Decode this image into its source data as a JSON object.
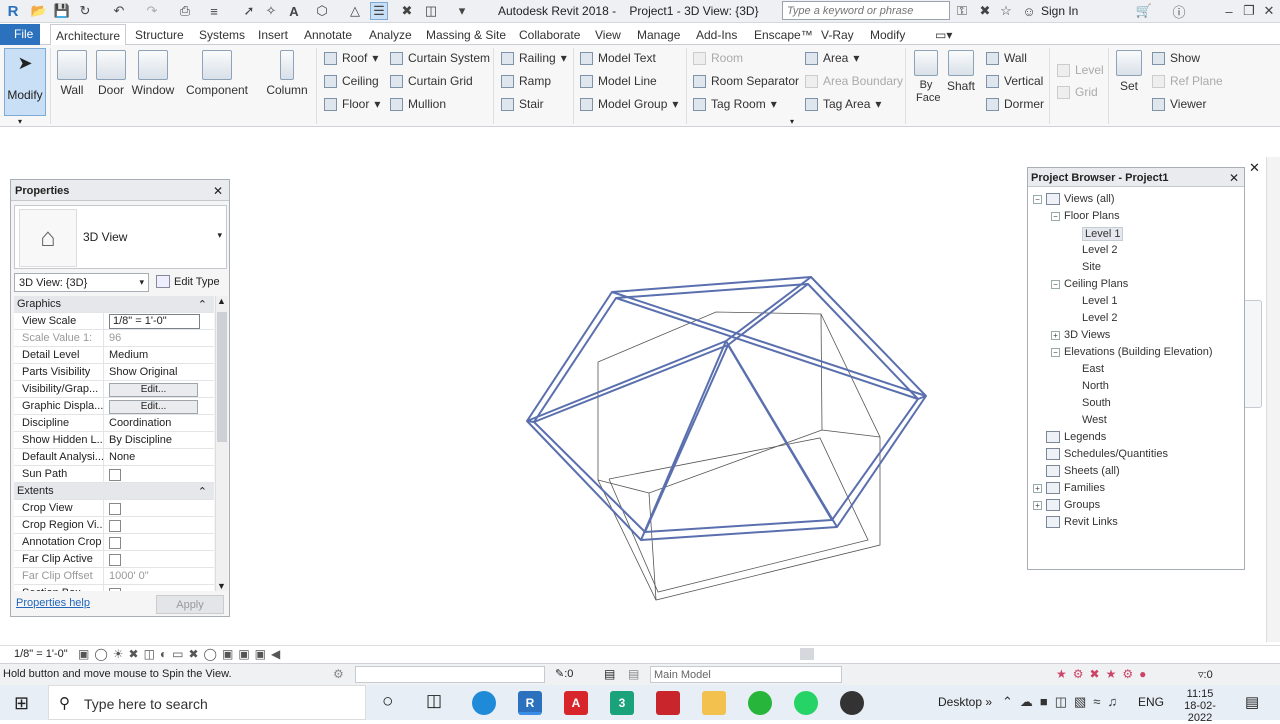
{
  "window": {
    "title_app": "Autodesk Revit 2018 -",
    "title_doc": "Project1 - 3D View: {3D}",
    "search_placeholder": "Type a keyword or phrase",
    "signin": "Sign In"
  },
  "tabs": [
    "File",
    "Architecture",
    "Structure",
    "Systems",
    "Insert",
    "Annotate",
    "Analyze",
    "Massing & Site",
    "Collaborate",
    "View",
    "Manage",
    "Add-Ins",
    "Enscape™",
    "V-Ray",
    "Modify"
  ],
  "ribbon": {
    "modify": "Modify",
    "big": [
      "Wall",
      "Door",
      "Window",
      "Component",
      "Column"
    ],
    "roof": "Roof",
    "ceiling": "Ceiling",
    "floor": "Floor",
    "curtain_system": "Curtain System",
    "curtain_grid": "Curtain Grid",
    "mullion": "Mullion",
    "railing": "Railing",
    "ramp": "Ramp",
    "stair": "Stair",
    "model_text": "Model Text",
    "model_line": "Model Line",
    "model_group": "Model Group",
    "room": "Room",
    "room_separator": "Room Separator",
    "tag_room": "Tag Room",
    "area": "Area",
    "area_boundary": "Area Boundary",
    "tag_area": "Tag Area",
    "by_face": "By Face",
    "shaft": "Shaft",
    "wall": "Wall",
    "vertical": "Vertical",
    "dormer": "Dormer",
    "level": "Level",
    "grid": "Grid",
    "set": "Set",
    "show": "Show",
    "ref_plane": "Ref Plane",
    "viewer": "Viewer"
  },
  "properties": {
    "title": "Properties",
    "type_name": "3D View",
    "view_selector": "3D View: {3D}",
    "edit_type": "Edit Type",
    "rows": [
      {
        "cat": "Graphics"
      },
      {
        "k": "View Scale",
        "v": "1/8\" = 1'-0\"",
        "input": true
      },
      {
        "k": "Scale Value    1:",
        "v": "96",
        "dim": true
      },
      {
        "k": "Detail Level",
        "v": "Medium"
      },
      {
        "k": "Parts Visibility",
        "v": "Show Original"
      },
      {
        "k": "Visibility/Grap...",
        "v": "Edit...",
        "btn": true
      },
      {
        "k": "Graphic Displa...",
        "v": "Edit...",
        "btn": true
      },
      {
        "k": "Discipline",
        "v": "Coordination"
      },
      {
        "k": "Show Hidden L...",
        "v": "By Discipline"
      },
      {
        "k": "Default Analysi...",
        "v": "None"
      },
      {
        "k": "Sun Path",
        "chk": true
      },
      {
        "cat": "Extents"
      },
      {
        "k": "Crop View",
        "chk": true
      },
      {
        "k": "Crop Region Vi...",
        "chk": true
      },
      {
        "k": "Annotation Crop",
        "chk": true
      },
      {
        "k": "Far Clip Active",
        "chk": true
      },
      {
        "k": "Far Clip Offset",
        "v": "1000'  0\"",
        "dim": true
      },
      {
        "k": "Section Box",
        "chk": true
      }
    ],
    "help": "Properties help",
    "apply": "Apply"
  },
  "browser": {
    "title": "Project Browser - Project1",
    "nodes": [
      {
        "label": "Views (all)",
        "lvl": 0,
        "tog": "-"
      },
      {
        "label": "Floor Plans",
        "lvl": 1,
        "tog": "-"
      },
      {
        "label": "Level 1",
        "lvl": 2,
        "sel": true
      },
      {
        "label": "Level 2",
        "lvl": 2
      },
      {
        "label": "Site",
        "lvl": 2
      },
      {
        "label": "Ceiling Plans",
        "lvl": 1,
        "tog": "-"
      },
      {
        "label": "Level 1",
        "lvl": 2
      },
      {
        "label": "Level 2",
        "lvl": 2
      },
      {
        "label": "3D Views",
        "lvl": 1,
        "tog": "+"
      },
      {
        "label": "Elevations (Building Elevation)",
        "lvl": 1,
        "tog": "-"
      },
      {
        "label": "East",
        "lvl": 2
      },
      {
        "label": "North",
        "lvl": 2
      },
      {
        "label": "South",
        "lvl": 2
      },
      {
        "label": "West",
        "lvl": 2
      },
      {
        "label": "Legends",
        "lvl": 0,
        "icon": true
      },
      {
        "label": "Schedules/Quantities",
        "lvl": 0,
        "icon": true
      },
      {
        "label": "Sheets (all)",
        "lvl": 0,
        "icon": true
      },
      {
        "label": "Families",
        "lvl": 0,
        "tog": "+",
        "icon": true
      },
      {
        "label": "Groups",
        "lvl": 0,
        "tog": "+",
        "icon": true
      },
      {
        "label": "Revit Links",
        "lvl": 0,
        "icon": true
      }
    ]
  },
  "viewbar": {
    "scale": "1/8\" = 1'-0\""
  },
  "status": {
    "message": "Hold button and move mouse to Spin the View.",
    "zero1": ":0",
    "model": "Main Model",
    "zero2": ":0"
  },
  "taskbar": {
    "search": "Type here to search",
    "desktop": "Desktop",
    "lang": "ENG",
    "time": "11:15",
    "date": "18-02-2022"
  },
  "colors": {
    "accent": "#2b71bd",
    "mass_edge": "#5a6fae"
  }
}
